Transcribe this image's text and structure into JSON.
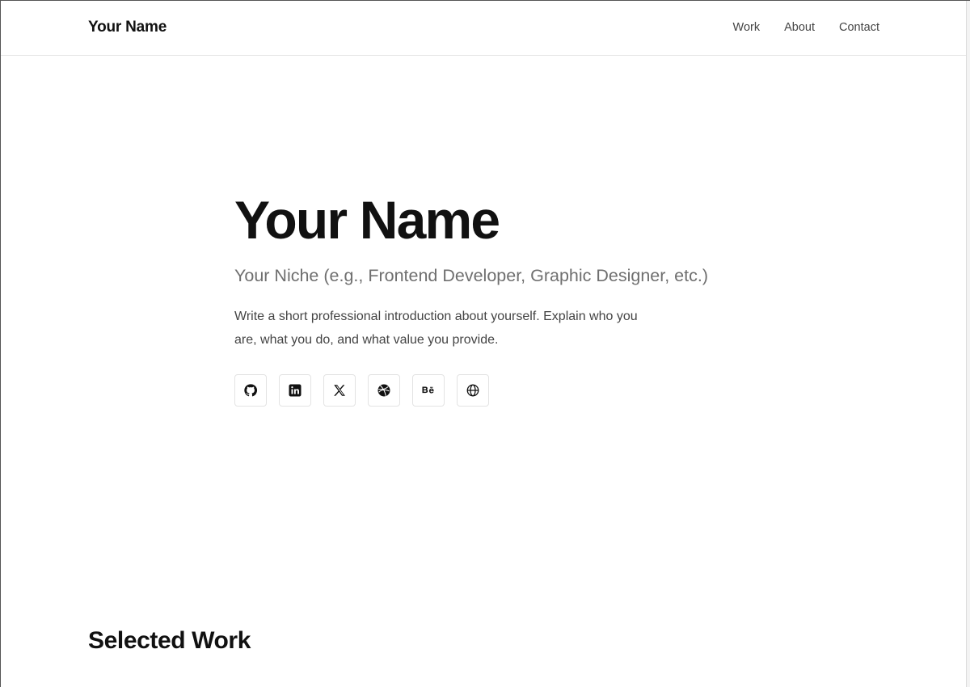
{
  "header": {
    "brand": "Your Name",
    "nav": [
      {
        "label": "Work"
      },
      {
        "label": "About"
      },
      {
        "label": "Contact"
      }
    ]
  },
  "hero": {
    "title": "Your Name",
    "niche": "Your Niche (e.g., Frontend Developer, Graphic Designer, etc.)",
    "intro": "Write a short professional introduction about yourself. Explain who you are, what you do, and what value you provide.",
    "socials": [
      {
        "icon": "github-icon"
      },
      {
        "icon": "linkedin-icon"
      },
      {
        "icon": "x-twitter-icon"
      },
      {
        "icon": "dribbble-icon"
      },
      {
        "icon": "behance-icon"
      },
      {
        "icon": "globe-icon"
      }
    ]
  },
  "sections": {
    "selected_work": "Selected Work"
  }
}
